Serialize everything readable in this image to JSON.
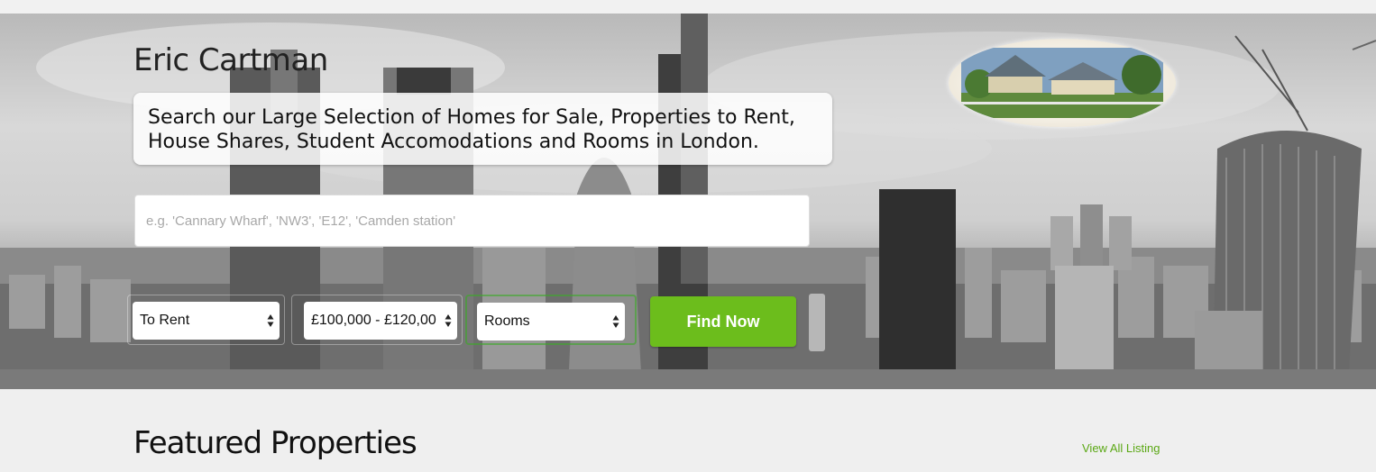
{
  "site": {
    "brand_name": "Eric Cartman",
    "tagline": "Search our Large Selection of Homes for Sale, Properties to Rent, House Shares, Student Accomodations and Rooms in London."
  },
  "search": {
    "value": "",
    "placeholder": "e.g. 'Cannary Wharf', 'NW3', 'E12', 'Camden station'"
  },
  "filters": {
    "listing_type": "To Rent",
    "price_range": "£100,000 - £120,00",
    "property_type": "Rooms"
  },
  "actions": {
    "find_label": "Find Now",
    "view_all_label": "View All Listing"
  },
  "featured": {
    "heading": "Featured Properties"
  },
  "colors": {
    "accent_green": "#6cbd1c",
    "link_green": "#5ba815",
    "page_bg": "#efefef"
  },
  "icons": {
    "select_arrows": "updown-arrows-icon",
    "logo": "house-logo"
  }
}
